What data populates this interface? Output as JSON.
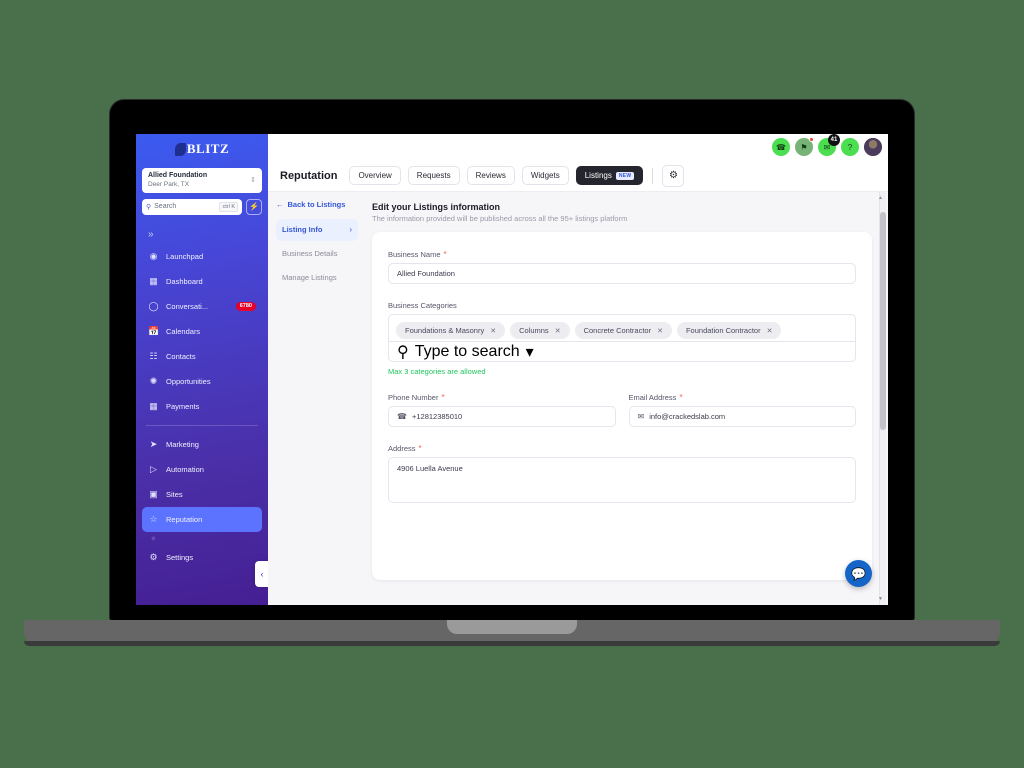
{
  "background_color": "#4a6f4b",
  "sidebar": {
    "brand": "BLITZ",
    "brand_icon": "blitz-logo-icon",
    "org": {
      "name": "Allied Foundation",
      "location": "Deer Park, TX",
      "caret_icon": "chevron-updown-icon"
    },
    "search": {
      "placeholder": "Search",
      "shortcut": "ctrl K",
      "icon": "search-icon"
    },
    "quick_action_icon": "bolt-icon",
    "expand_icon": "double-chevron-right-icon",
    "items": [
      {
        "label": "Launchpad",
        "icon": "rocket-icon",
        "badge": "",
        "active": false
      },
      {
        "label": "Dashboard",
        "icon": "grid-icon",
        "badge": "",
        "active": false
      },
      {
        "label": "Conversati...",
        "icon": "chat-bubble-icon",
        "badge": "6780",
        "active": false
      },
      {
        "label": "Calendars",
        "icon": "calendar-icon",
        "badge": "",
        "active": false
      },
      {
        "label": "Contacts",
        "icon": "contacts-icon",
        "badge": "",
        "active": false
      },
      {
        "label": "Opportunities",
        "icon": "opportunities-icon",
        "badge": "",
        "active": false
      },
      {
        "label": "Payments",
        "icon": "payments-icon",
        "badge": "",
        "active": false
      }
    ],
    "items_lower": [
      {
        "label": "Marketing",
        "icon": "paper-plane-icon",
        "active": false
      },
      {
        "label": "Automation",
        "icon": "play-circle-icon",
        "active": false
      },
      {
        "label": "Sites",
        "icon": "sites-icon",
        "active": false
      },
      {
        "label": "Reputation",
        "icon": "star-icon",
        "active": true
      }
    ],
    "settings": {
      "label": "Settings",
      "icon": "gear-icon"
    },
    "collapse_icon": "chevron-left-icon"
  },
  "topbar": {
    "icons": [
      {
        "name": "phone-icon",
        "glyph": "✆",
        "badge": "",
        "dot": false
      },
      {
        "name": "megaphone-icon",
        "glyph": "⚑",
        "badge": "",
        "dot": true
      },
      {
        "name": "notification-icon",
        "glyph": "✉",
        "badge": "41",
        "dot": false
      },
      {
        "name": "help-icon",
        "glyph": "?",
        "badge": "",
        "dot": false
      },
      {
        "name": "avatar",
        "glyph": "",
        "badge": "",
        "dot": false
      }
    ]
  },
  "module_bar": {
    "title": "Reputation",
    "tabs": [
      {
        "label": "Overview",
        "active": false,
        "badge": ""
      },
      {
        "label": "Requests",
        "active": false,
        "badge": ""
      },
      {
        "label": "Reviews",
        "active": false,
        "badge": ""
      },
      {
        "label": "Widgets",
        "active": false,
        "badge": ""
      },
      {
        "label": "Listings",
        "active": true,
        "badge": "NEW"
      }
    ],
    "settings_icon": "gear-icon"
  },
  "list_nav": {
    "back_label": "Back to Listings",
    "back_icon": "arrow-left-icon",
    "steps": [
      {
        "label": "Listing Info",
        "active": true,
        "chevron": "›"
      },
      {
        "label": "Business Details",
        "active": false,
        "chevron": ""
      },
      {
        "label": "Manage Listings",
        "active": false,
        "chevron": ""
      }
    ]
  },
  "panel": {
    "title": "Edit your Listings information",
    "subtitle": "The information provided will be published across all the 95+ listings platform",
    "fields": {
      "business_name": {
        "label": "Business Name",
        "required": true,
        "value": "Allied Foundation"
      },
      "business_categories": {
        "label": "Business Categories",
        "required": false,
        "chips": [
          "Foundations & Masonry",
          "Columns",
          "Concrete Contractor",
          "Foundation Contractor"
        ],
        "chip_remove_icon": "close-icon",
        "search_placeholder": "Type to search",
        "search_icon": "search-icon",
        "dropdown_icon": "chevron-down-icon",
        "hint": "Max 3 categories are allowed",
        "hint_color": "#22c55e"
      },
      "phone_number": {
        "label": "Phone Number",
        "required": true,
        "value": "+12812385010",
        "icon": "phone-icon"
      },
      "email_address": {
        "label": "Email Address",
        "required": true,
        "value": "info@crackedslab.com",
        "icon": "envelope-icon"
      },
      "address": {
        "label": "Address",
        "required": true,
        "value": "4906 Luella Avenue"
      }
    }
  },
  "chat_widget": {
    "icon": "chat-info-icon",
    "color": "#1565c9"
  }
}
